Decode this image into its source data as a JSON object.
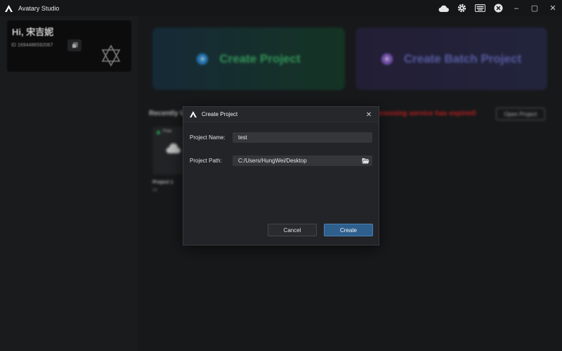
{
  "titlebar": {
    "title": "Avatary Studio",
    "icons": [
      "cloud-icon",
      "gear-icon",
      "keyboard-icon",
      "avatar-icon"
    ],
    "window_controls": {
      "minimize": "–",
      "maximize": "▢",
      "close": "✕"
    }
  },
  "sidebar": {
    "greeting": "Hi, 宋吉妮",
    "user_id": "ID 1694486592067"
  },
  "main": {
    "create_project_label": "Create Project",
    "create_batch_label": "Create Batch Project",
    "recent_label": "Recently U",
    "expired_message": "ocessing service has expired!",
    "open_project_label": "Open Project",
    "project": {
      "badge": "Free",
      "name": "Project 1",
      "sub": "08"
    }
  },
  "dialog": {
    "title": "Create Project",
    "close": "✕",
    "name_label": "Project Name:",
    "name_value": "test",
    "path_label": "Project Path:",
    "path_value": "C:/Users/HungWei/Desktop",
    "cancel_label": "Cancel",
    "create_label": "Create"
  },
  "colors": {
    "accent_blue": "#2f5f8d",
    "create_green": "#3fb76d",
    "batch_purple": "#6c72c9",
    "expired_red": "#e02727"
  }
}
